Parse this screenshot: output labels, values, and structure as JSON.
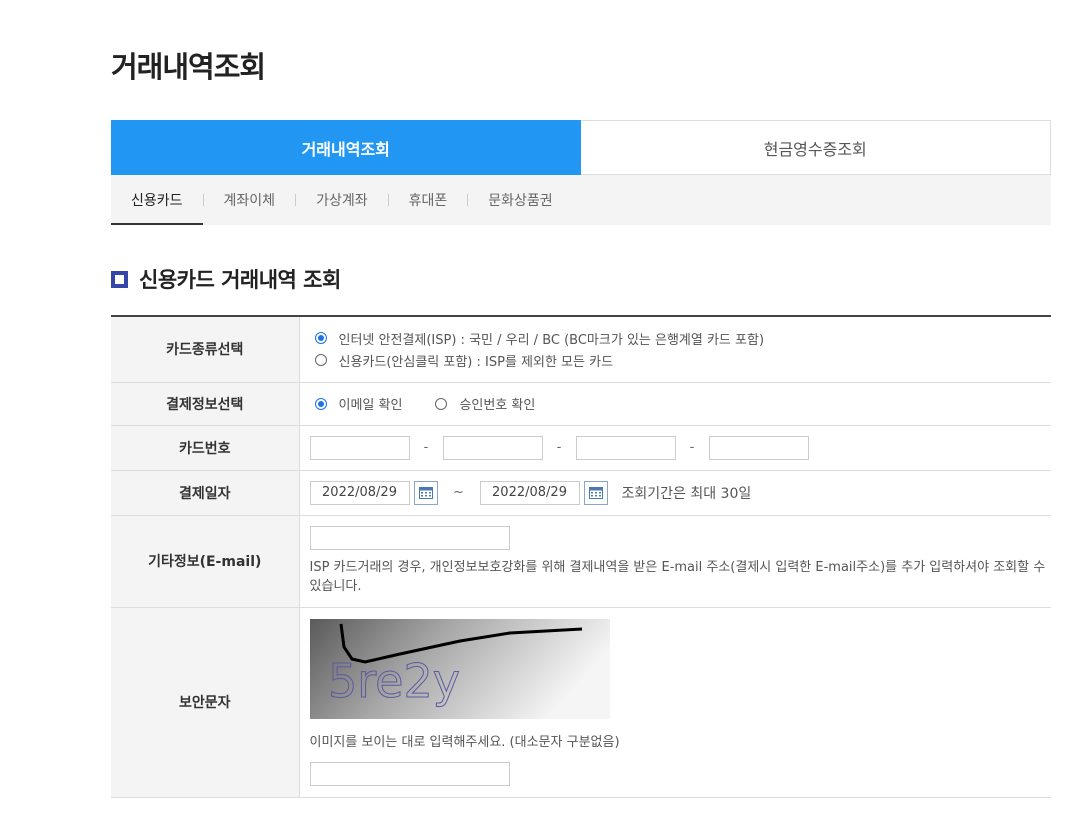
{
  "page": {
    "title": "거래내역조회"
  },
  "main_tabs": [
    {
      "label": "거래내역조회",
      "active": true
    },
    {
      "label": "현금영수증조회",
      "active": false
    }
  ],
  "sub_tabs": [
    {
      "label": "신용카드",
      "active": true
    },
    {
      "label": "계좌이체",
      "active": false
    },
    {
      "label": "가상계좌",
      "active": false
    },
    {
      "label": "휴대폰",
      "active": false
    },
    {
      "label": "문화상품권",
      "active": false
    }
  ],
  "section": {
    "title": "신용카드 거래내역 조회"
  },
  "form": {
    "card_type": {
      "label": "카드종류선택",
      "options": [
        {
          "label": "인터넷 안전결제(ISP) : 국민 / 우리 / BC (BC마크가 있는 은행계열 카드 포함)",
          "checked": true
        },
        {
          "label": "신용카드(안심클릭 포함) : ISP를 제외한 모든 카드",
          "checked": false
        }
      ]
    },
    "payment_info": {
      "label": "결제정보선택",
      "options": [
        {
          "label": "이메일 확인",
          "checked": true
        },
        {
          "label": "승인번호 확인",
          "checked": false
        }
      ]
    },
    "card_number": {
      "label": "카드번호",
      "separator": "-",
      "fields": [
        "",
        "",
        "",
        ""
      ]
    },
    "payment_date": {
      "label": "결제일자",
      "start": "2022/08/29",
      "end": "2022/08/29",
      "separator": "~",
      "note": "조회기간은 최대 30일"
    },
    "extra_info": {
      "label": "기타정보(E-mail)",
      "value": "",
      "help": "ISP 카드거래의 경우, 개인정보보호강화를 위해 결제내역을 받은 E-mail 주소(결제시 입력한 E-mail주소)를 추가 입력하셔야 조회할 수 있습니다."
    },
    "security": {
      "label": "보안문자",
      "captcha_text": "5re2y",
      "help": "이미지를 보이는 대로 입력해주세요. (대소문자 구분없음)",
      "value": ""
    }
  },
  "colors": {
    "accent": "#2196f3",
    "section_icon": "#3446a8",
    "radio_checked": "#1a73e8"
  }
}
